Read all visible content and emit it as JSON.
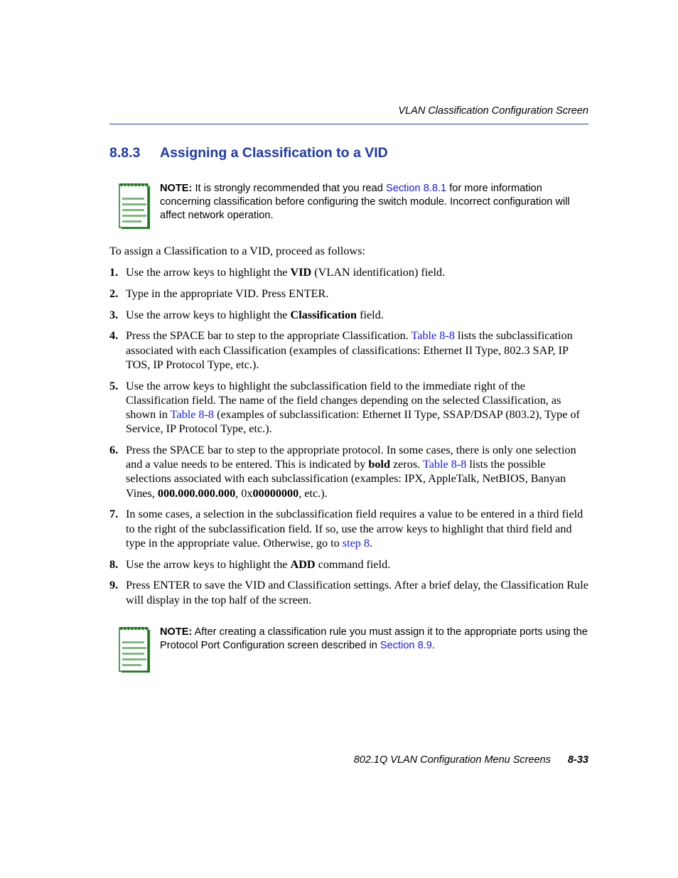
{
  "header": {
    "running_title": "VLAN Classification Configuration Screen"
  },
  "section": {
    "number": "8.8.3",
    "title": "Assigning a Classification to a VID"
  },
  "note1": {
    "label": "NOTE:",
    "text_before_link": " It is strongly recommended that you read ",
    "link": "Section 8.8.1",
    "text_after_link": " for more information concerning classification before configuring the switch module. Incorrect configuration will affect network operation.",
    "icon": "notepad-icon"
  },
  "intro": "To assign a Classification to a VID, proceed as follows:",
  "steps": [
    {
      "num": "1.",
      "parts": [
        "Use the arrow keys to highlight the ",
        "VID",
        " (VLAN identification) field."
      ]
    },
    {
      "num": "2.",
      "parts": [
        "Type in the appropriate VID. Press ENTER."
      ]
    },
    {
      "num": "3.",
      "parts": [
        "Use the arrow keys to highlight the ",
        "Classification",
        " field."
      ]
    },
    {
      "num": "4.",
      "parts": [
        "Press the SPACE bar to step to the appropriate Classification. ",
        "Table 8-8",
        " lists the subclassification associated with each Classification (examples of classifications: Ethernet II Type, 802.3 SAP, IP TOS, IP Protocol Type, etc.)."
      ]
    },
    {
      "num": "5.",
      "parts": [
        "Use the arrow keys to highlight the subclassification field to the immediate right of the Classification field. The name of the field changes depending on the selected Classification, as shown in ",
        "Table 8-8",
        " (examples of subclassification: Ethernet II Type, SSAP/DSAP (803.2), Type of Service, IP Protocol Type, etc.)."
      ]
    },
    {
      "num": "6.",
      "parts": [
        "Press the SPACE bar to step to the appropriate protocol. In some cases, there is only one selection and a value needs to be entered. This is indicated by ",
        "bold",
        " zeros. ",
        "Table 8-8",
        " lists the possible selections associated with each subclassification (examples: IPX, AppleTalk, NetBIOS, Banyan Vines, ",
        "000.000.000.000",
        ", 0x",
        "00000000",
        ", etc.)."
      ]
    },
    {
      "num": "7.",
      "parts": [
        "In some cases, a selection in the subclassification field requires a value to be entered in a third field to the right of the subclassification field. If so, use the arrow keys to highlight that third field and type in the appropriate value. Otherwise, go to ",
        "step 8",
        "."
      ]
    },
    {
      "num": "8.",
      "parts": [
        "Use the arrow keys to highlight the ",
        "ADD",
        " command field."
      ]
    },
    {
      "num": "9.",
      "parts": [
        "Press ENTER to save the VID and Classification settings. After a brief delay, the Classification Rule will display in the top half of the screen."
      ]
    }
  ],
  "note2": {
    "label": "NOTE:",
    "text_before_link": " After creating a classification rule you must assign it to the appropriate ports using the Protocol Port Configuration screen described in ",
    "link": "Section 8.9",
    "text_after_link": ".",
    "icon": "notepad-icon"
  },
  "footer": {
    "title": "802.1Q VLAN Configuration Menu Screens",
    "page_number": "8-33"
  },
  "colors": {
    "heading": "#1f3aa8",
    "rule": "#2b3f9c",
    "link": "#1a1ae6",
    "icon_green": "#1e7a1e",
    "icon_lines": "#7fb87f"
  }
}
